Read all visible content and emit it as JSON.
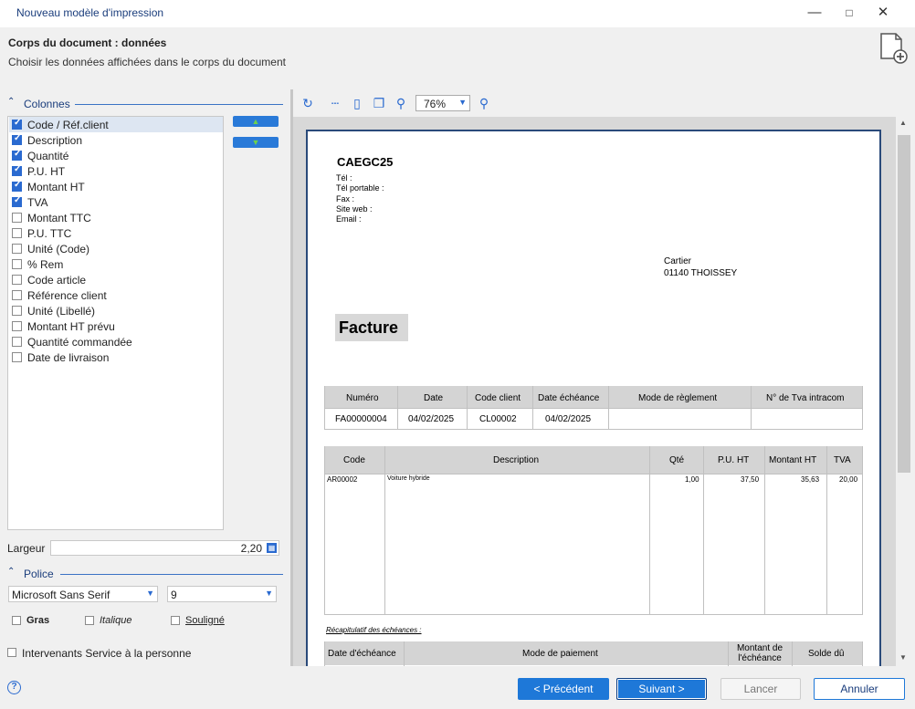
{
  "window": {
    "title": "Nouveau modèle d'impression"
  },
  "header": {
    "title": "Corps du document : données",
    "subtitle": "Choisir les données affichées dans le corps du document"
  },
  "columns_section": {
    "label": "Colonnes",
    "items": [
      {
        "label": "Code / Réf.client",
        "checked": true
      },
      {
        "label": "Description",
        "checked": true
      },
      {
        "label": "Quantité",
        "checked": true
      },
      {
        "label": "P.U. HT",
        "checked": true
      },
      {
        "label": "Montant HT",
        "checked": true
      },
      {
        "label": "TVA",
        "checked": true
      },
      {
        "label": "Montant TTC",
        "checked": false
      },
      {
        "label": "P.U. TTC",
        "checked": false
      },
      {
        "label": "Unité (Code)",
        "checked": false
      },
      {
        "label": "% Rem",
        "checked": false
      },
      {
        "label": "Code article",
        "checked": false
      },
      {
        "label": "Référence client",
        "checked": false
      },
      {
        "label": "Unité (Libellé)",
        "checked": false
      },
      {
        "label": "Montant HT prévu",
        "checked": false
      },
      {
        "label": "Quantité commandée",
        "checked": false
      },
      {
        "label": "Date de livraison",
        "checked": false
      }
    ],
    "width_label": "Largeur",
    "width_value": "2,20"
  },
  "font_section": {
    "label": "Police",
    "font_name": "Microsoft Sans Serif",
    "font_size": "9",
    "bold_label": "Gras",
    "italic_label": "Italique",
    "underline_label": "Souligné"
  },
  "service_label": "Intervenants Service à la personne",
  "preview": {
    "zoom": "76%",
    "company": "CAEGC25",
    "contact_lines": [
      "Tél :",
      "Tél portable :",
      "Fax :",
      "Site web :",
      "Email :"
    ],
    "recipient_name": "Cartier",
    "recipient_city": "01140 THOISSEY",
    "doc_type": "Facture",
    "info_headers": [
      "Numéro",
      "Date",
      "Code client",
      "Date échéance",
      "Mode de règlement",
      "N° de Tva intracom"
    ],
    "info_values": [
      "FA00000004",
      "04/02/2025",
      "CL00002",
      "04/02/2025",
      "",
      ""
    ],
    "line_headers": [
      "Code",
      "Description",
      "Qté",
      "P.U. HT",
      "Montant HT",
      "TVA"
    ],
    "line_row": [
      "AR00002",
      "Voiture hybride",
      "1,00",
      "37,50",
      "35,63",
      "20,00"
    ],
    "recap_title": "Récapitulatif des échéances :",
    "recap_headers": [
      "Date d'échéance",
      "Mode de paiement",
      "Montant de l'échéance",
      "Solde dû"
    ]
  },
  "footer": {
    "prev": "< Précédent",
    "next": "Suivant >",
    "launch": "Lancer",
    "cancel": "Annuler"
  }
}
